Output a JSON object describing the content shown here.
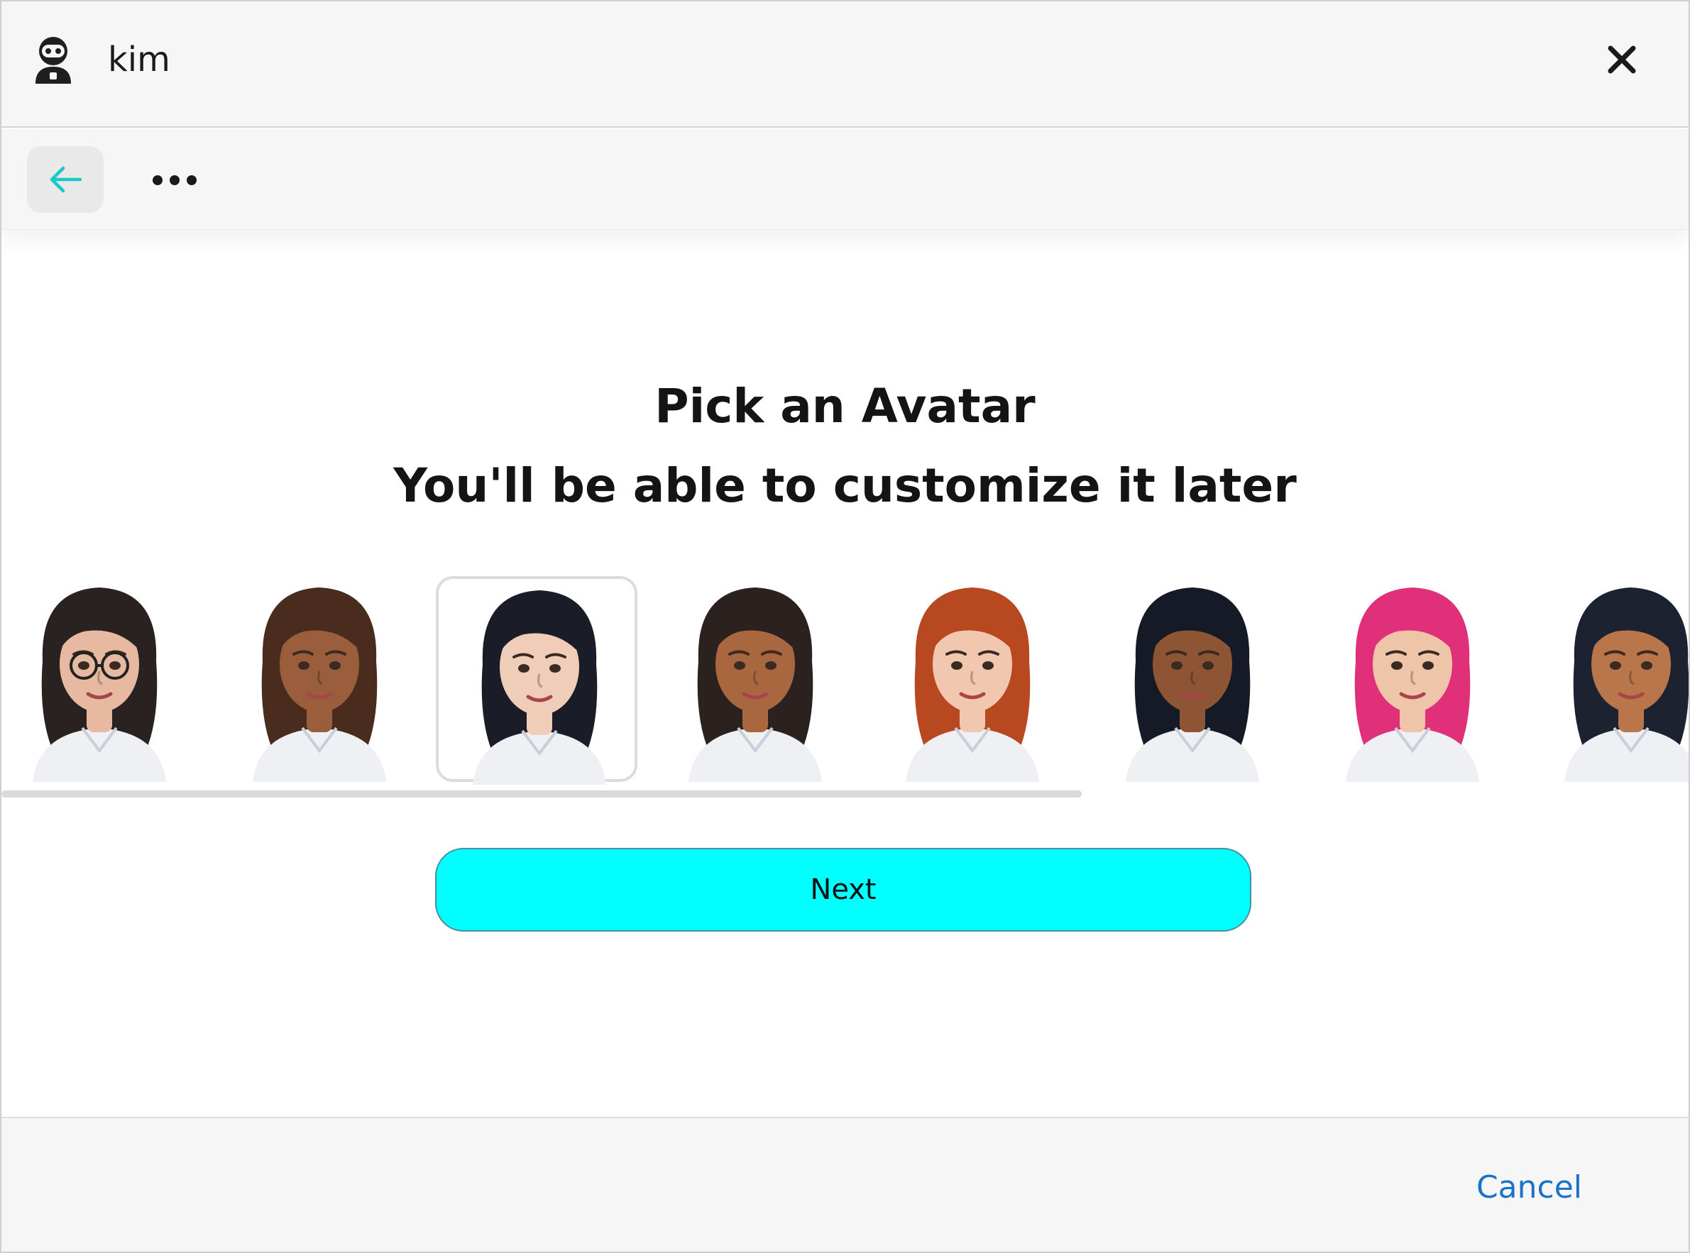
{
  "titlebar": {
    "app_name": "kim",
    "app_icon": "robot-avatar-icon",
    "close_icon": "close-icon"
  },
  "toolbar": {
    "back_icon": "back-arrow-icon",
    "more_icon": "more-options-icon",
    "accent_color": "#19c8c8"
  },
  "main": {
    "title": "Pick an Avatar",
    "subtitle": "You'll be able to customize it later"
  },
  "avatars": [
    {
      "hair": "#2a2220",
      "skin": "#e6b9a0",
      "glasses": true,
      "selected": false
    },
    {
      "hair": "#4a2c1f",
      "skin": "#9a5e3c",
      "glasses": false,
      "selected": false
    },
    {
      "hair": "#1a1c28",
      "skin": "#f0cdb8",
      "glasses": false,
      "selected": true
    },
    {
      "hair": "#2b211e",
      "skin": "#a8673f",
      "glasses": false,
      "selected": false
    },
    {
      "hair": "#b8481f",
      "skin": "#f2c7b0",
      "glasses": false,
      "selected": false
    },
    {
      "hair": "#161a26",
      "skin": "#8e5535",
      "glasses": false,
      "selected": false
    },
    {
      "hair": "#e0307a",
      "skin": "#efc5aa",
      "glasses": false,
      "selected": false
    },
    {
      "hair": "#1d2230",
      "skin": "#b8764a",
      "glasses": false,
      "selected": false
    }
  ],
  "actions": {
    "next_label": "Next",
    "next_color": "#00ffff",
    "cancel_label": "Cancel",
    "cancel_color": "#1a73c9"
  }
}
